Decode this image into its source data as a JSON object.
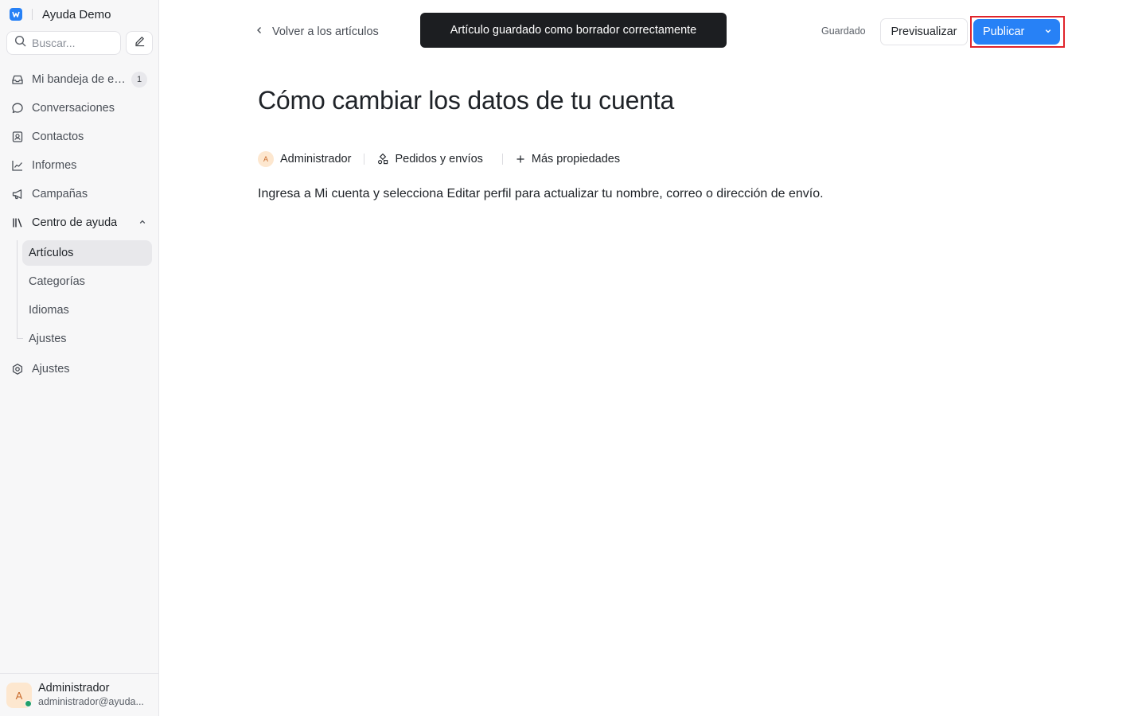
{
  "brand": {
    "name": "Ayuda Demo"
  },
  "search": {
    "placeholder": "Buscar..."
  },
  "sidebar": {
    "items": [
      {
        "label": "Mi bandeja de entrada",
        "badge": "1",
        "icon": "inbox-icon"
      },
      {
        "label": "Conversaciones",
        "icon": "chat-bubble-icon"
      },
      {
        "label": "Contactos",
        "icon": "contacts-icon"
      },
      {
        "label": "Informes",
        "icon": "line-chart-icon"
      },
      {
        "label": "Campañas",
        "icon": "megaphone-icon"
      },
      {
        "label": "Centro de ayuda",
        "icon": "library-icon",
        "expanded": true
      },
      {
        "label": "Ajustes",
        "icon": "settings-icon"
      }
    ],
    "help_center_subitems": [
      {
        "label": "Artículos",
        "active": true
      },
      {
        "label": "Categorías"
      },
      {
        "label": "Idiomas"
      },
      {
        "label": "Ajustes"
      }
    ]
  },
  "user": {
    "initial": "A",
    "name": "Administrador",
    "email": "administrador@ayuda..."
  },
  "header": {
    "back_label": "Volver a los artículos",
    "toast": "Artículo guardado como borrador correctamente",
    "saved_status": "Guardado",
    "preview_label": "Previsualizar",
    "publish_label": "Publicar"
  },
  "article": {
    "title": "Cómo cambiar los datos de tu cuenta",
    "author_initial": "A",
    "author": "Administrador",
    "category": "Pedidos y envíos",
    "more_properties": "Más propiedades",
    "body": "Ingresa a Mi cuenta y selecciona Editar perfil para actualizar tu nombre, correo o dirección de envío."
  },
  "colors": {
    "accent": "#2781f6",
    "highlight": "#e0242b",
    "toast_bg": "#1c1e21"
  }
}
